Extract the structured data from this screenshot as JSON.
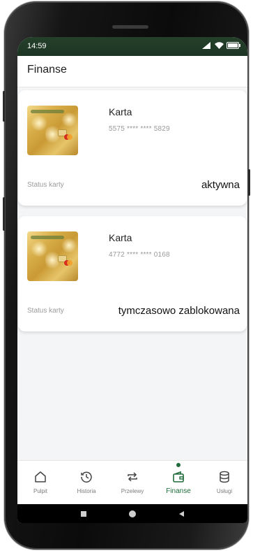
{
  "status_bar": {
    "time": "14:59"
  },
  "header": {
    "title": "Finanse"
  },
  "cards": [
    {
      "name": "Karta",
      "number": "5575 **** **** 5829",
      "status_label": "Status karty",
      "status_value": "aktywna"
    },
    {
      "name": "Karta",
      "number": "4772 **** **** 0168",
      "status_label": "Status karty",
      "status_value": "tymczasowo zablokowana"
    }
  ],
  "nav": [
    {
      "label": "Pulpit",
      "icon": "home-icon"
    },
    {
      "label": "Historia",
      "icon": "history-icon"
    },
    {
      "label": "Przelewy",
      "icon": "transfer-icon"
    },
    {
      "label": "Finanse",
      "icon": "wallet-icon",
      "active": true
    },
    {
      "label": "Usługi",
      "icon": "database-icon"
    }
  ],
  "colors": {
    "accent": "#1f6b3a",
    "status_bar": "#1d3524"
  }
}
